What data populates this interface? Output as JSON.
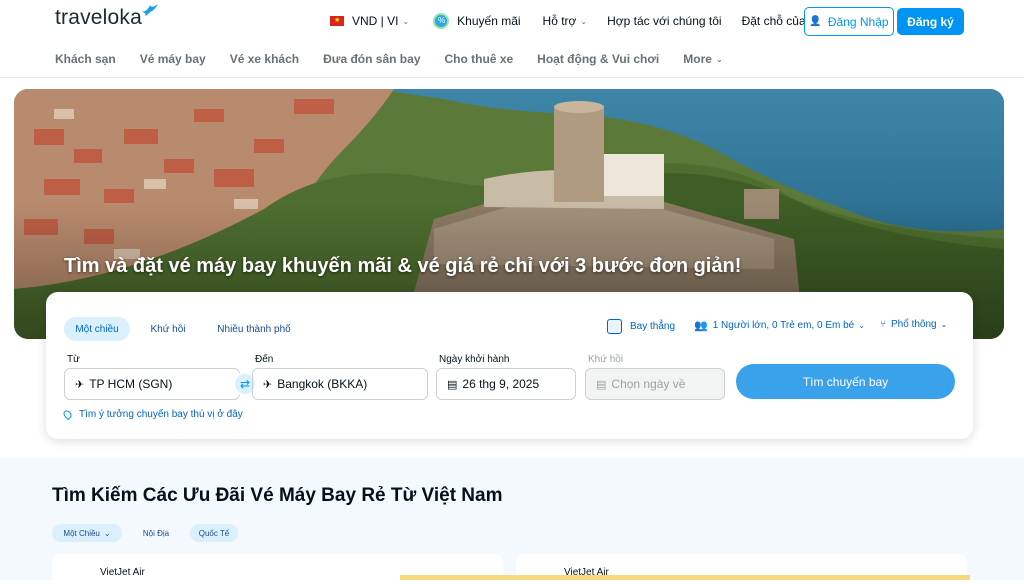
{
  "header": {
    "logo": "traveloka",
    "currency": "VND | VI",
    "links": [
      "Khuyến mãi",
      "Hỗ trợ",
      "Hợp tác với chúng tôi",
      "Đặt chỗ của tôi"
    ],
    "login": "Đăng Nhập",
    "register": "Đăng ký"
  },
  "nav": {
    "items": [
      "Khách sạn",
      "Vé máy bay",
      "Vé xe khách",
      "Đưa đón sân bay",
      "Cho thuê xe",
      "Hoạt động & Vui chơi",
      "More"
    ]
  },
  "hero": {
    "title": "Tìm và đặt vé máy bay khuyến mãi & vé giá rẻ chỉ với 3 bước đơn giản!"
  },
  "search": {
    "trip_types": [
      "Một chiều",
      "Khứ hồi",
      "Nhiều thành phố"
    ],
    "direct_flight": "Bay thẳng",
    "passengers": "1 Người lớn, 0 Trẻ em, 0 Em bé",
    "cabin": "Phổ thông",
    "from_label": "Từ",
    "from_value": "TP HCM (SGN)",
    "to_label": "Đến",
    "to_value": "Bangkok (BKKA)",
    "depart_label": "Ngày khởi hành",
    "depart_value": "26 thg 9, 2025",
    "return_label": "Khứ hồi",
    "return_placeholder": "Chọn ngày về",
    "search_button": "Tìm chuyến bay",
    "idea_link": "Tìm ý tưởng chuyến bay thú vị ở đây"
  },
  "deals": {
    "title": "Tìm Kiếm Các Ưu Đãi Vé Máy Bay Rẻ Từ Việt Nam",
    "filters": [
      "Một Chiều",
      "Nội Địa",
      "Quốc Tế"
    ],
    "cards": [
      "VietJet Air",
      "VietJet Air"
    ]
  },
  "colors": {
    "brand_blue": "#0194f3",
    "search_button": "#3aa2eb",
    "active_tab_bg": "#daf0fd"
  }
}
